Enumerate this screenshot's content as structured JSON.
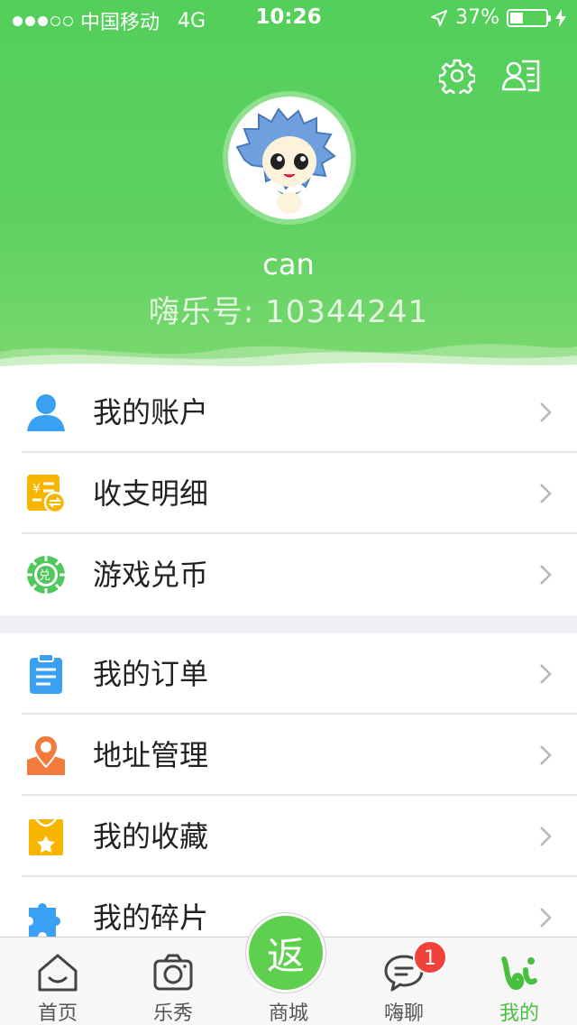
{
  "status_bar": {
    "carrier": "中国移动",
    "network": "4G",
    "time": "10:26",
    "battery": "37%",
    "battery_level": 0.37,
    "signal_bars": 3
  },
  "profile": {
    "username": "can",
    "user_id": "嗨乐号: 10344241"
  },
  "header_icons": [
    "gear-icon",
    "contact-card-icon"
  ],
  "colors": {
    "brand_green": "#55cf5b",
    "active_tab": "#47bf3f",
    "badge_red": "#f2403a"
  },
  "menu": {
    "group1": [
      {
        "label": "我的账户",
        "icon": "user-icon"
      },
      {
        "label": "收支明细",
        "icon": "bill-icon"
      },
      {
        "label": "游戏兑币",
        "icon": "coin-exchange-icon"
      }
    ],
    "group2": [
      {
        "label": "我的订单",
        "icon": "clipboard-icon"
      },
      {
        "label": "地址管理",
        "icon": "location-pin-icon"
      },
      {
        "label": "我的收藏",
        "icon": "favorite-bag-icon"
      },
      {
        "label": "我的碎片",
        "icon": "puzzle-icon"
      }
    ]
  },
  "tabbar": {
    "tabs": [
      {
        "label": "首页",
        "icon": "home-icon"
      },
      {
        "label": "乐秀",
        "icon": "camera-icon"
      },
      {
        "label": "商城",
        "icon": "return-icon"
      },
      {
        "label": "嗨聊",
        "icon": "chat-icon"
      },
      {
        "label": "我的",
        "icon": "profile-logo-icon"
      }
    ],
    "center_glyph": "返",
    "chat_badge": "1",
    "active_index": 4
  }
}
